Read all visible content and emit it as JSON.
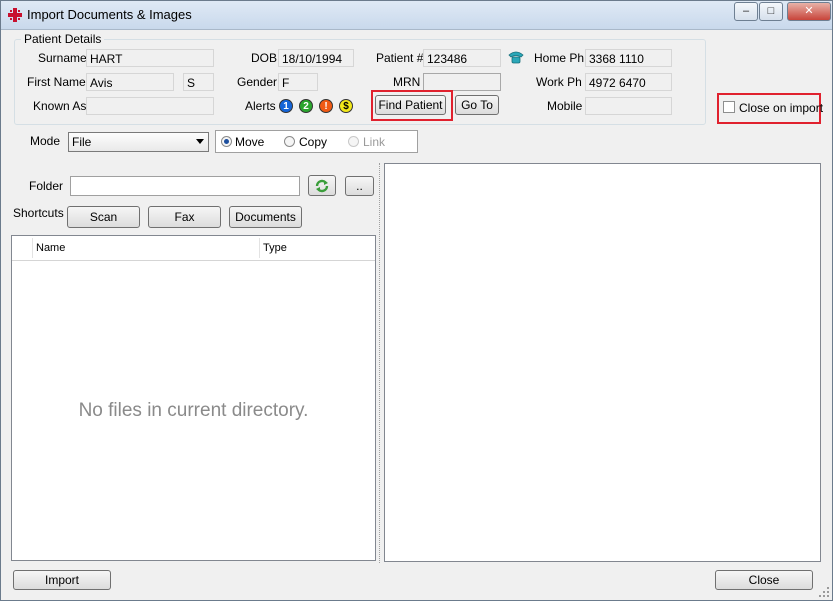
{
  "window": {
    "title": "Import Documents & Images"
  },
  "patient_details": {
    "group_title": "Patient Details",
    "surname_label": "Surname",
    "surname": "HART",
    "first_name_label": "First Name",
    "first_name": "Avis",
    "initial": "S",
    "known_as_label": "Known As",
    "known_as": "",
    "dob_label": "DOB",
    "dob": "18/10/1994",
    "gender_label": "Gender",
    "gender": "F",
    "alerts_label": "Alerts",
    "alert_icons": [
      "1",
      "2",
      "!",
      "$"
    ],
    "patient_no_label": "Patient #",
    "patient_no": "123486",
    "mrn_label": "MRN",
    "mrn": "",
    "home_ph_label": "Home Ph",
    "home_ph": "3368 1110",
    "work_ph_label": "Work Ph",
    "work_ph": "4972 6470",
    "mobile_label": "Mobile",
    "mobile": "",
    "find_patient_label": "Find Patient",
    "goto_label": "Go To",
    "close_on_import_label": "Close on import"
  },
  "mode": {
    "label": "Mode",
    "selected": "File",
    "options": {
      "move": "Move",
      "copy": "Copy",
      "link": "Link"
    }
  },
  "folder": {
    "label": "Folder",
    "value": "",
    "browse_label": ".."
  },
  "shortcuts": {
    "label": "Shortcuts",
    "scan": "Scan",
    "fax": "Fax",
    "documents": "Documents"
  },
  "file_list": {
    "columns": [
      "Name",
      "Type"
    ],
    "empty_message": "No files in current directory."
  },
  "footer": {
    "import_label": "Import",
    "close_label": "Close"
  },
  "colors": {
    "highlight_box": "#e0212e",
    "alert1": "#1565d8",
    "alert2": "#2aa52e",
    "alert3": "#f05a14",
    "alert4": "#f2e81a"
  }
}
